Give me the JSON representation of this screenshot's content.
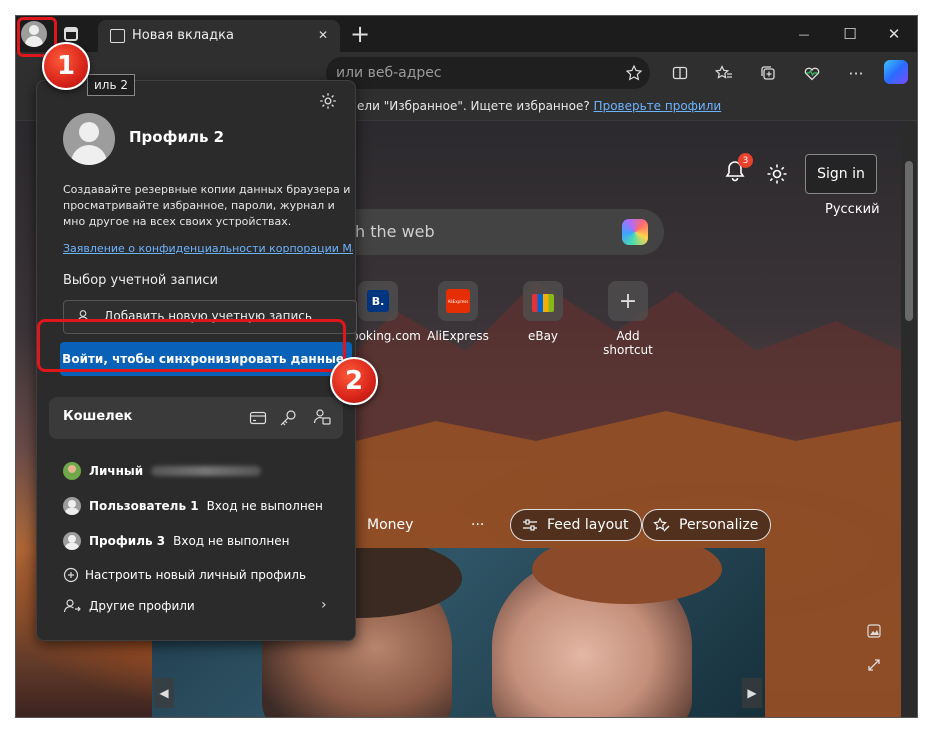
{
  "titlebar": {
    "tab_title": "Новая вкладка",
    "new_tab_symbol": "+",
    "minimize_symbol": "—",
    "maximize_symbol": "☐",
    "close_symbol": "✕",
    "tab_close_symbol": "✕"
  },
  "toolbar": {
    "address_placeholder": "или веб-адрес"
  },
  "favorites_bar": {
    "message": "панели \"Избранное\". Ищете избранное?",
    "link": "Проверьте профили"
  },
  "newtab": {
    "notification_count": "3",
    "sign_in_label": "Sign in",
    "language": "Русский",
    "search_placeholder": "rch the web",
    "shortcuts": [
      {
        "label": "Booking.com",
        "glyph": "B."
      },
      {
        "label": "AliExpress",
        "glyph": "AliExpress"
      },
      {
        "label": "eBay",
        "glyph": ""
      },
      {
        "label": "Add shortcut",
        "glyph": "+"
      }
    ],
    "feed_tab_partial": "y",
    "feed_tab_money": "Money",
    "feed_more": "···",
    "feed_layout_label": "Feed layout",
    "personalize_label": "Personalize"
  },
  "profile_popup": {
    "tooltip": "иль 2",
    "profile_name": "Профиль 2",
    "description": "Создавайте резервные копии данных браузера и просматривайте избранное, пароли, журнал и мно другое на всех своих устройствах.",
    "privacy_link": "Заявление о конфиденциальности корпорации Ма",
    "account_section_title": "Выбор учетной записи",
    "add_account_label": "Добавить новую учетную запись",
    "sync_button_label": "Войти, чтобы синхронизировать данные",
    "wallet_title": "Кошелек",
    "profiles": [
      {
        "name": "Личный",
        "status": ""
      },
      {
        "name": "Пользователь 1",
        "status": "Вход не выполнен"
      },
      {
        "name": "Профиль 3",
        "status": "Вход не выполнен"
      }
    ],
    "setup_profile_label": "Настроить новый личный профиль",
    "other_profiles_label": "Другие профили"
  },
  "callouts": {
    "step1": "1",
    "step2": "2",
    "color": "#e0161d"
  }
}
